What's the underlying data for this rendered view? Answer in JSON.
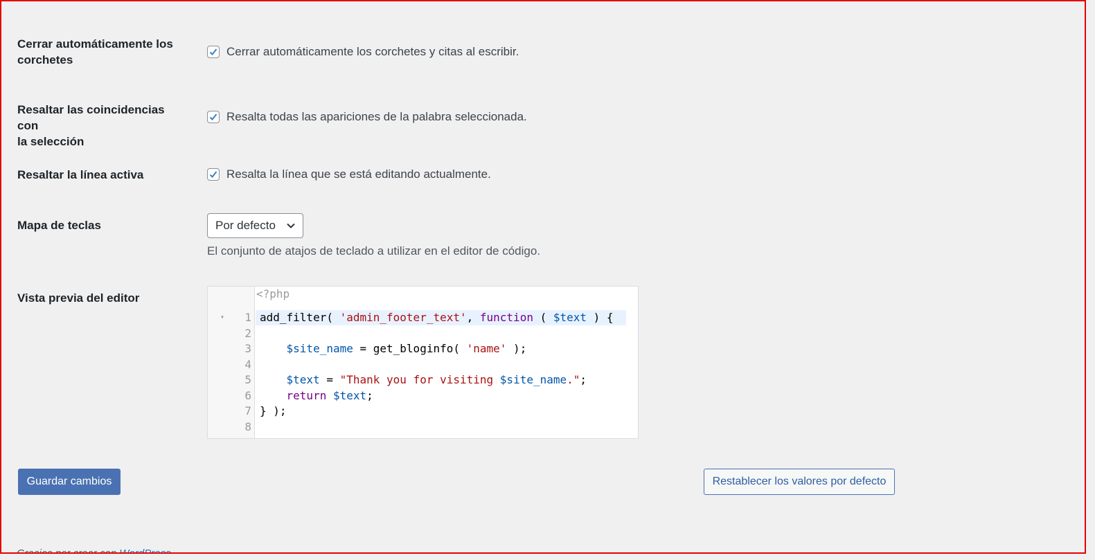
{
  "settings": {
    "auto_close_brackets": {
      "label_line1": "Cerrar automáticamente los",
      "label_line2": "corchetes",
      "checkbox_text": "Cerrar automáticamente los corchetes y citas al escribir.",
      "checked": true
    },
    "highlight_matches": {
      "label_line1": "Resaltar las coincidencias con",
      "label_line2": "la selección",
      "checkbox_text": "Resalta todas las apariciones de la palabra seleccionada.",
      "checked": true
    },
    "highlight_active_line": {
      "label": "Resaltar la línea activa",
      "checkbox_text": "Resalta la línea que se está editando actualmente.",
      "checked": true
    },
    "keymap": {
      "label": "Mapa de teclas",
      "selected": "Por defecto",
      "description": "El conjunto de atajos de teclado a utilizar en el editor de código."
    },
    "editor_preview": {
      "label": "Vista previa del editor",
      "header": "<?php",
      "line_numbers": [
        "1",
        "2",
        "3",
        "4",
        "5",
        "6",
        "7",
        "8"
      ],
      "lines": [
        [
          [
            "text",
            "add_filter( "
          ],
          [
            "string",
            "'admin_footer_text'"
          ],
          [
            "text",
            ", "
          ],
          [
            "keyword",
            "function"
          ],
          [
            "text",
            " ( "
          ],
          [
            "var",
            "$text"
          ],
          [
            "text",
            " ) {"
          ]
        ],
        [],
        [
          [
            "text",
            "    "
          ],
          [
            "var",
            "$site_name"
          ],
          [
            "text",
            " = get_bloginfo( "
          ],
          [
            "string",
            "'name'"
          ],
          [
            "text",
            " );"
          ]
        ],
        [],
        [
          [
            "text",
            "    "
          ],
          [
            "var",
            "$text"
          ],
          [
            "text",
            " = "
          ],
          [
            "string",
            "\"Thank you for visiting "
          ],
          [
            "var",
            "$site_name"
          ],
          [
            "string",
            ".\""
          ],
          [
            "text",
            ";"
          ]
        ],
        [
          [
            "text",
            "    "
          ],
          [
            "keyword",
            "return"
          ],
          [
            "text",
            " "
          ],
          [
            "var",
            "$text"
          ],
          [
            "text",
            ";"
          ]
        ],
        [
          [
            "text",
            "} );"
          ]
        ],
        []
      ]
    }
  },
  "buttons": {
    "save": "Guardar cambios",
    "reset": "Restablecer los valores por defecto"
  },
  "footer": {
    "text": "Gracias por crear con ",
    "link": "WordPress"
  },
  "icons": {
    "checkmark": "checkmark-icon",
    "chevron": "chevron-down-icon",
    "fold": "fold-arrow-icon"
  },
  "colors": {
    "primary": "#4a72b2",
    "frame_border": "#e60000",
    "active_line": "#e8f2ff"
  }
}
